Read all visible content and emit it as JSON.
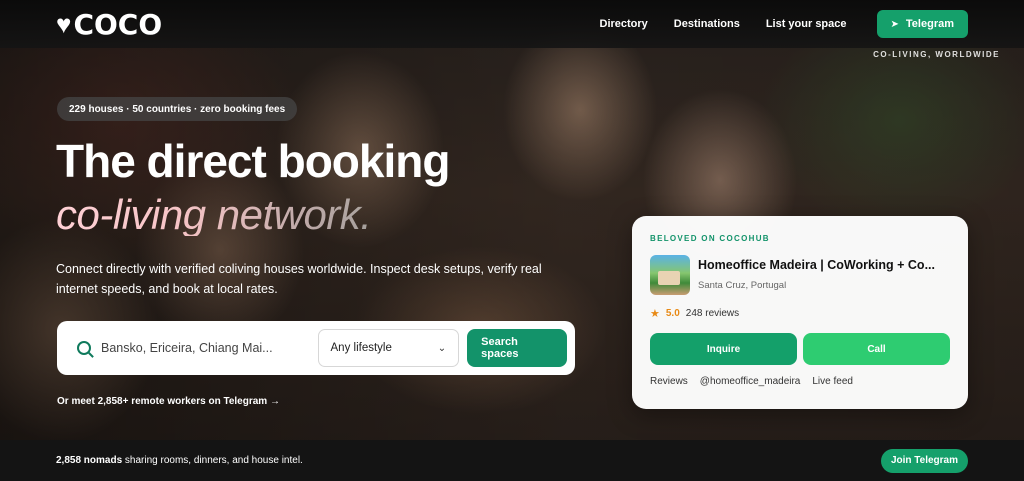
{
  "brand": {
    "logo_text": "COCO"
  },
  "nav": {
    "links": [
      "Directory",
      "Destinations",
      "List your space"
    ],
    "telegram_label": "Telegram"
  },
  "hero": {
    "corner_tagline": "CO-LIVING, WORLDWIDE",
    "pill": "229 houses · 50 countries · zero booking fees",
    "title_line1": "The direct booking",
    "title_line2": "co-living network.",
    "subtitle": "Connect directly with verified coliving houses worldwide. Inspect desk setups, verify real internet speeds, and book at local rates."
  },
  "search": {
    "placeholder": "Bansko, Ericeira, Chiang Mai...",
    "lifestyle_selected": "Any lifestyle",
    "button_label": "Search spaces"
  },
  "meet_link": "Or meet 2,858+ remote workers on Telegram →",
  "card": {
    "eyebrow": "BELOVED ON COCOHUB",
    "title": "Homeoffice Madeira | CoWorking + Co...",
    "location": "Santa Cruz, Portugal",
    "rating": "5.0",
    "reviews": "248 reviews",
    "inquire_label": "Inquire",
    "call_label": "Call",
    "links": [
      "Reviews",
      "@homeoffice_madeira",
      "Live feed"
    ]
  },
  "bottom_bar": {
    "count": "2,858 nomads",
    "text": " sharing rooms, dinners, and house intel.",
    "join_label": "Join Telegram"
  },
  "colors": {
    "accent": "#15a06b",
    "call": "#2ecc71",
    "rating": "#e88a16"
  }
}
